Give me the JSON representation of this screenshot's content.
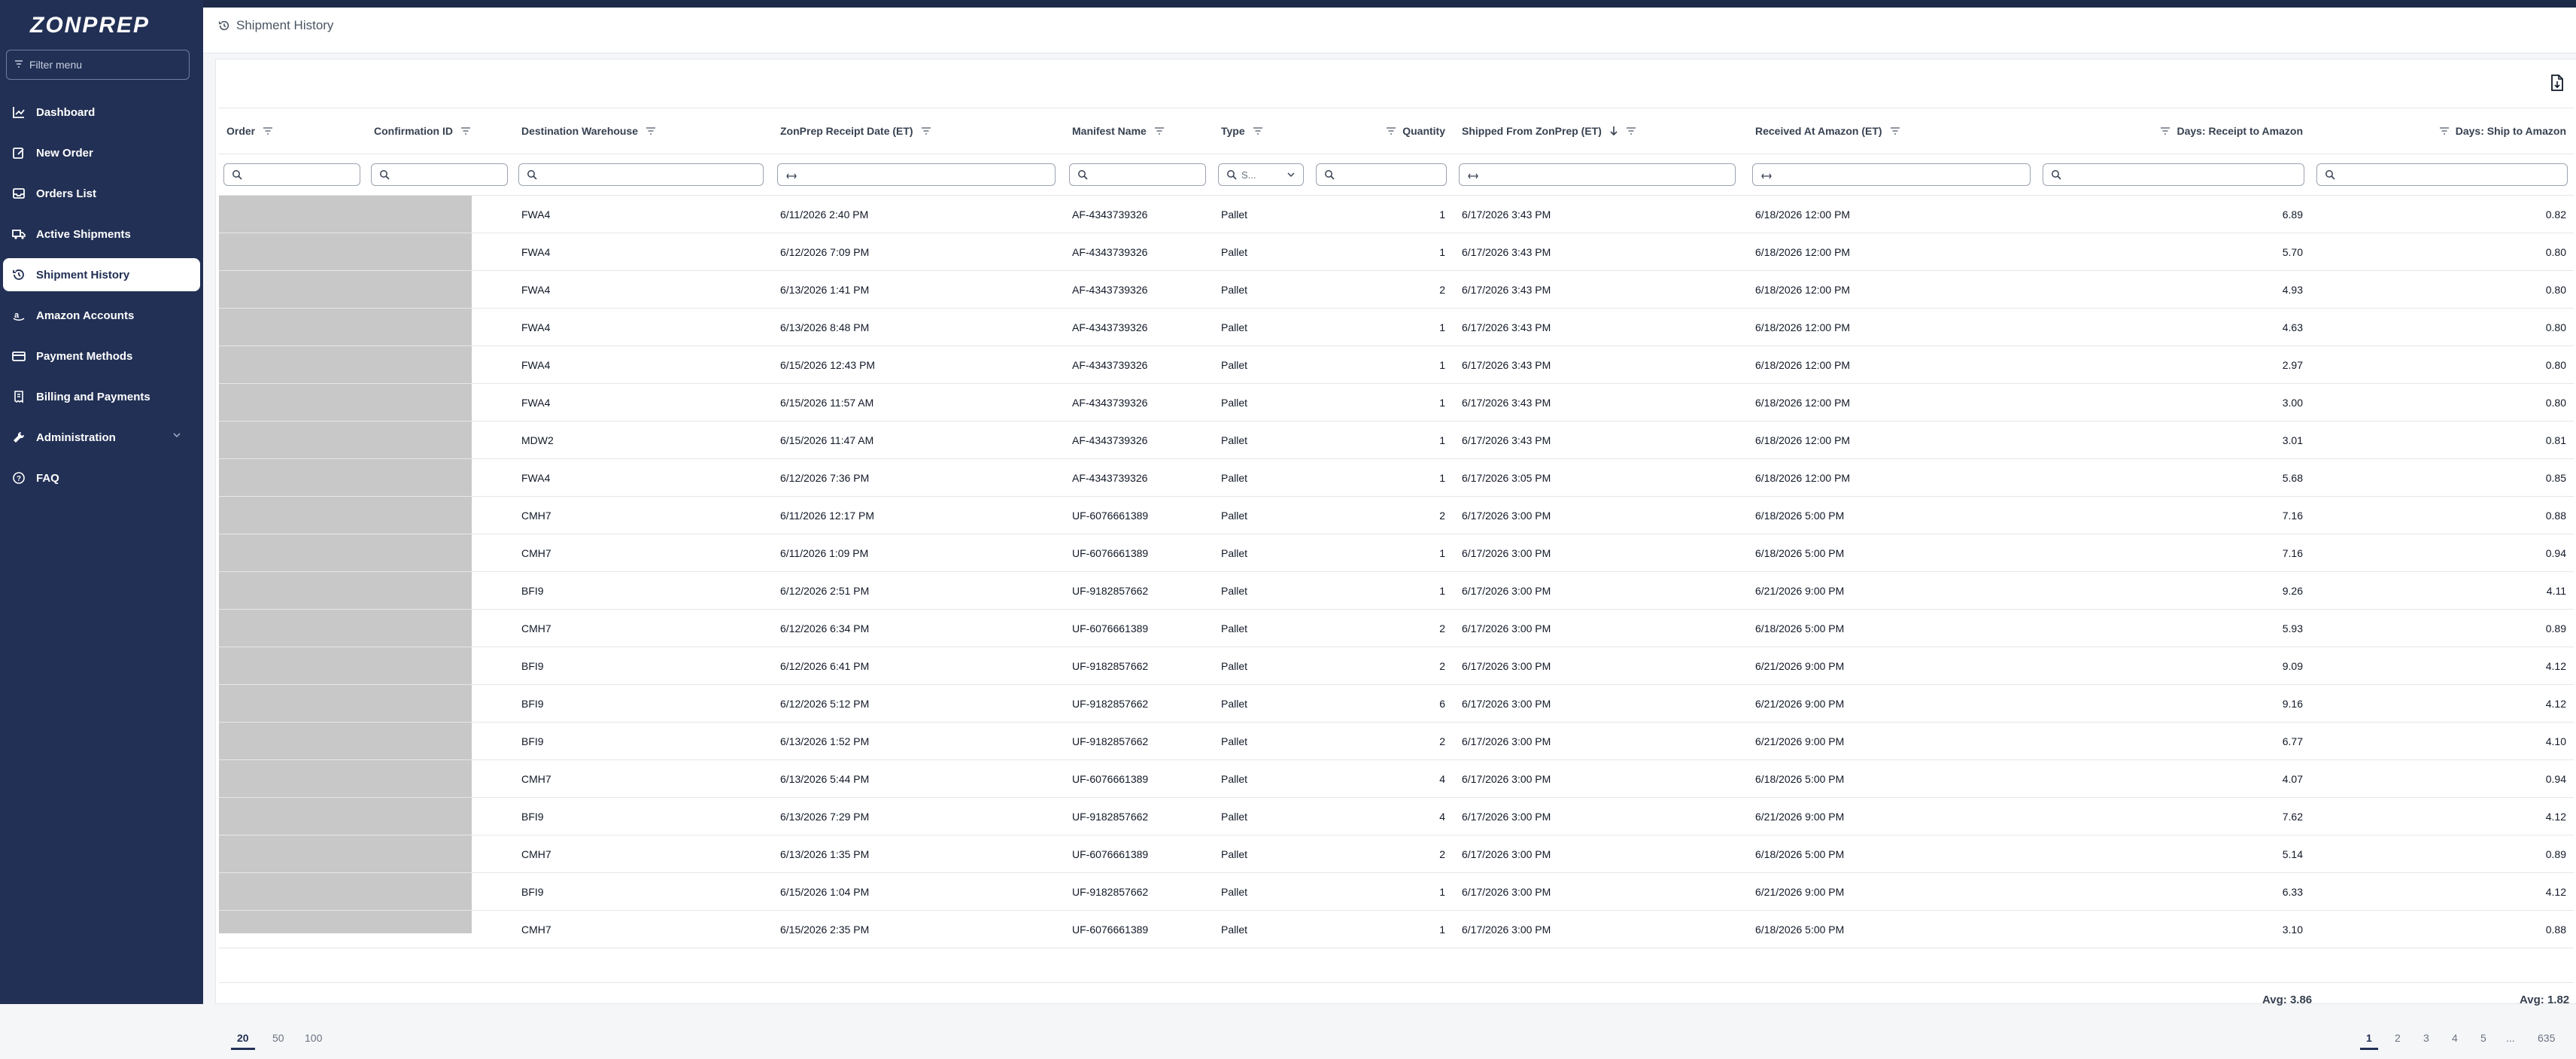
{
  "app": {
    "logo": "ZONPREP"
  },
  "sidebar": {
    "filter_placeholder": "Filter menu",
    "items": [
      {
        "label": "Dashboard"
      },
      {
        "label": "New Order"
      },
      {
        "label": "Orders List"
      },
      {
        "label": "Active Shipments"
      },
      {
        "label": "Shipment History"
      },
      {
        "label": "Amazon Accounts"
      },
      {
        "label": "Payment Methods"
      },
      {
        "label": "Billing and Payments"
      },
      {
        "label": "Administration"
      },
      {
        "label": "FAQ"
      }
    ]
  },
  "header": {
    "title": "Shipment History"
  },
  "table": {
    "columns": [
      {
        "label": "Order"
      },
      {
        "label": "Confirmation ID"
      },
      {
        "label": "Destination Warehouse"
      },
      {
        "label": "ZonPrep Receipt Date (ET)"
      },
      {
        "label": "Manifest Name"
      },
      {
        "label": "Type"
      },
      {
        "label": "Quantity"
      },
      {
        "label": "Shipped From ZonPrep (ET)"
      },
      {
        "label": "Received At Amazon (ET)"
      },
      {
        "label": "Days: Receipt to Amazon"
      },
      {
        "label": "Days: Ship to Amazon"
      }
    ],
    "type_filter_placeholder": "S...",
    "rows": [
      {
        "dest": "FWA4",
        "receipt": "6/11/2026 2:40 PM",
        "manifest": "AF-4343739326",
        "type": "Pallet",
        "qty": "1",
        "shipped": "6/17/2026 3:43 PM",
        "received": "6/18/2026 12:00 PM",
        "d_receipt": "6.89",
        "d_ship": "0.82"
      },
      {
        "dest": "FWA4",
        "receipt": "6/12/2026 7:09 PM",
        "manifest": "AF-4343739326",
        "type": "Pallet",
        "qty": "1",
        "shipped": "6/17/2026 3:43 PM",
        "received": "6/18/2026 12:00 PM",
        "d_receipt": "5.70",
        "d_ship": "0.80"
      },
      {
        "dest": "FWA4",
        "receipt": "6/13/2026 1:41 PM",
        "manifest": "AF-4343739326",
        "type": "Pallet",
        "qty": "2",
        "shipped": "6/17/2026 3:43 PM",
        "received": "6/18/2026 12:00 PM",
        "d_receipt": "4.93",
        "d_ship": "0.80"
      },
      {
        "dest": "FWA4",
        "receipt": "6/13/2026 8:48 PM",
        "manifest": "AF-4343739326",
        "type": "Pallet",
        "qty": "1",
        "shipped": "6/17/2026 3:43 PM",
        "received": "6/18/2026 12:00 PM",
        "d_receipt": "4.63",
        "d_ship": "0.80"
      },
      {
        "dest": "FWA4",
        "receipt": "6/15/2026 12:43 PM",
        "manifest": "AF-4343739326",
        "type": "Pallet",
        "qty": "1",
        "shipped": "6/17/2026 3:43 PM",
        "received": "6/18/2026 12:00 PM",
        "d_receipt": "2.97",
        "d_ship": "0.80"
      },
      {
        "dest": "FWA4",
        "receipt": "6/15/2026 11:57 AM",
        "manifest": "AF-4343739326",
        "type": "Pallet",
        "qty": "1",
        "shipped": "6/17/2026 3:43 PM",
        "received": "6/18/2026 12:00 PM",
        "d_receipt": "3.00",
        "d_ship": "0.80"
      },
      {
        "dest": "MDW2",
        "receipt": "6/15/2026 11:47 AM",
        "manifest": "AF-4343739326",
        "type": "Pallet",
        "qty": "1",
        "shipped": "6/17/2026 3:43 PM",
        "received": "6/18/2026 12:00 PM",
        "d_receipt": "3.01",
        "d_ship": "0.81"
      },
      {
        "dest": "FWA4",
        "receipt": "6/12/2026 7:36 PM",
        "manifest": "AF-4343739326",
        "type": "Pallet",
        "qty": "1",
        "shipped": "6/17/2026 3:05 PM",
        "received": "6/18/2026 12:00 PM",
        "d_receipt": "5.68",
        "d_ship": "0.85"
      },
      {
        "dest": "CMH7",
        "receipt": "6/11/2026 12:17 PM",
        "manifest": "UF-6076661389",
        "type": "Pallet",
        "qty": "2",
        "shipped": "6/17/2026 3:00 PM",
        "received": "6/18/2026 5:00 PM",
        "d_receipt": "7.16",
        "d_ship": "0.88"
      },
      {
        "dest": "CMH7",
        "receipt": "6/11/2026 1:09 PM",
        "manifest": "UF-6076661389",
        "type": "Pallet",
        "qty": "1",
        "shipped": "6/17/2026 3:00 PM",
        "received": "6/18/2026 5:00 PM",
        "d_receipt": "7.16",
        "d_ship": "0.94"
      },
      {
        "dest": "BFI9",
        "receipt": "6/12/2026 2:51 PM",
        "manifest": "UF-9182857662",
        "type": "Pallet",
        "qty": "1",
        "shipped": "6/17/2026 3:00 PM",
        "received": "6/21/2026 9:00 PM",
        "d_receipt": "9.26",
        "d_ship": "4.11"
      },
      {
        "dest": "CMH7",
        "receipt": "6/12/2026 6:34 PM",
        "manifest": "UF-6076661389",
        "type": "Pallet",
        "qty": "2",
        "shipped": "6/17/2026 3:00 PM",
        "received": "6/18/2026 5:00 PM",
        "d_receipt": "5.93",
        "d_ship": "0.89"
      },
      {
        "dest": "BFI9",
        "receipt": "6/12/2026 6:41 PM",
        "manifest": "UF-9182857662",
        "type": "Pallet",
        "qty": "2",
        "shipped": "6/17/2026 3:00 PM",
        "received": "6/21/2026 9:00 PM",
        "d_receipt": "9.09",
        "d_ship": "4.12"
      },
      {
        "dest": "BFI9",
        "receipt": "6/12/2026 5:12 PM",
        "manifest": "UF-9182857662",
        "type": "Pallet",
        "qty": "6",
        "shipped": "6/17/2026 3:00 PM",
        "received": "6/21/2026 9:00 PM",
        "d_receipt": "9.16",
        "d_ship": "4.12"
      },
      {
        "dest": "BFI9",
        "receipt": "6/13/2026 1:52 PM",
        "manifest": "UF-9182857662",
        "type": "Pallet",
        "qty": "2",
        "shipped": "6/17/2026 3:00 PM",
        "received": "6/21/2026 9:00 PM",
        "d_receipt": "6.77",
        "d_ship": "4.10"
      },
      {
        "dest": "CMH7",
        "receipt": "6/13/2026 5:44 PM",
        "manifest": "UF-6076661389",
        "type": "Pallet",
        "qty": "4",
        "shipped": "6/17/2026 3:00 PM",
        "received": "6/18/2026 5:00 PM",
        "d_receipt": "4.07",
        "d_ship": "0.94"
      },
      {
        "dest": "BFI9",
        "receipt": "6/13/2026 7:29 PM",
        "manifest": "UF-9182857662",
        "type": "Pallet",
        "qty": "4",
        "shipped": "6/17/2026 3:00 PM",
        "received": "6/21/2026 9:00 PM",
        "d_receipt": "7.62",
        "d_ship": "4.12"
      },
      {
        "dest": "CMH7",
        "receipt": "6/13/2026 1:35 PM",
        "manifest": "UF-6076661389",
        "type": "Pallet",
        "qty": "2",
        "shipped": "6/17/2026 3:00 PM",
        "received": "6/18/2026 5:00 PM",
        "d_receipt": "5.14",
        "d_ship": "0.89"
      },
      {
        "dest": "BFI9",
        "receipt": "6/15/2026 1:04 PM",
        "manifest": "UF-9182857662",
        "type": "Pallet",
        "qty": "1",
        "shipped": "6/17/2026 3:00 PM",
        "received": "6/21/2026 9:00 PM",
        "d_receipt": "6.33",
        "d_ship": "4.12"
      },
      {
        "dest": "CMH7",
        "receipt": "6/15/2026 2:35 PM",
        "manifest": "UF-6076661389",
        "type": "Pallet",
        "qty": "1",
        "shipped": "6/17/2026 3:00 PM",
        "received": "6/18/2026 5:00 PM",
        "d_receipt": "3.10",
        "d_ship": "0.88"
      }
    ],
    "footer": {
      "avg_receipt": "Avg: 3.86",
      "avg_ship": "Avg: 1.82"
    }
  },
  "pagination": {
    "page_sizes": [
      "20",
      "50",
      "100"
    ],
    "pages": [
      "1",
      "2",
      "3",
      "4",
      "5",
      "...",
      "635"
    ],
    "current_page": "1",
    "current_size": "20"
  },
  "colors": {
    "sidebar": "#223055",
    "accent": "#223055",
    "redaction": "#c8c8c8"
  }
}
